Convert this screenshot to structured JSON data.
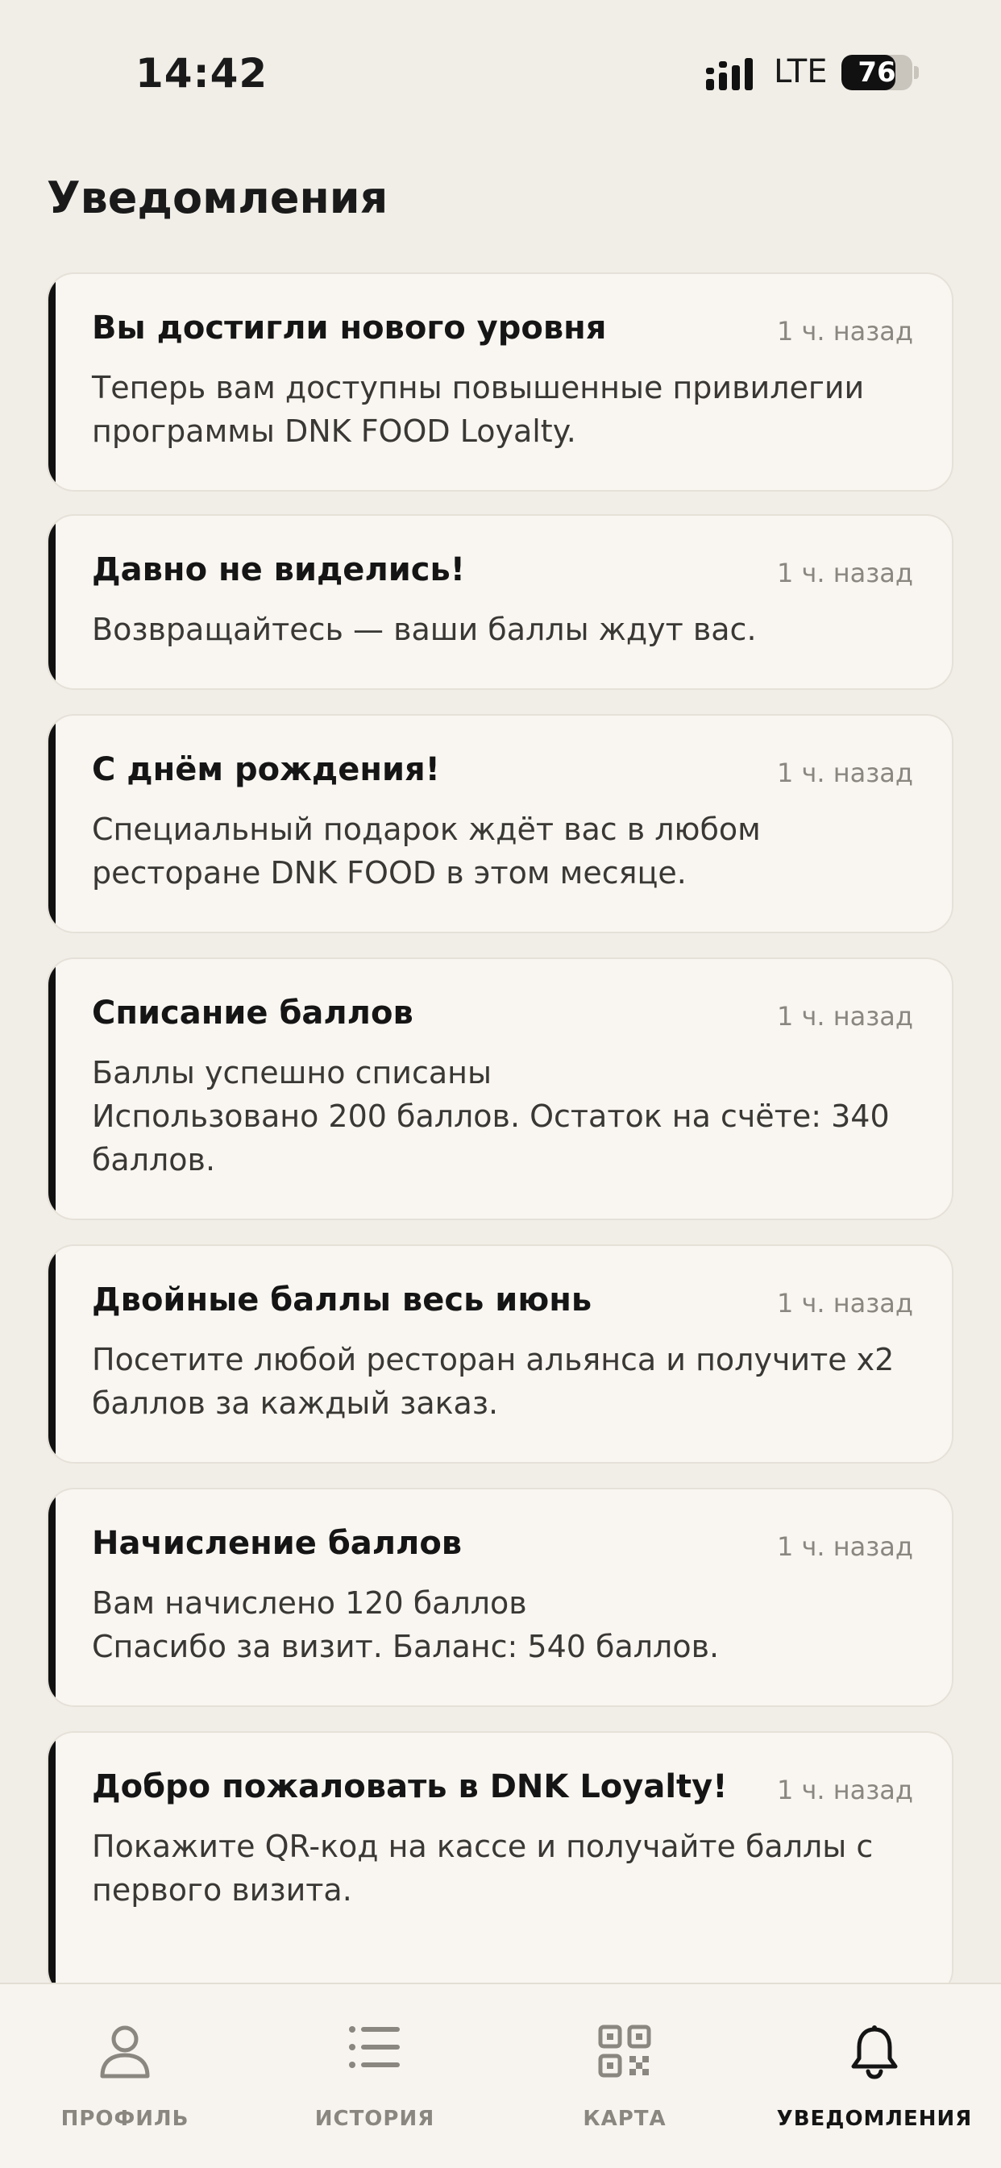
{
  "status_bar": {
    "time": "14:42",
    "network": "LTE",
    "battery_level": 76,
    "battery_text": "76"
  },
  "page_title": "Уведомления",
  "notifications": [
    {
      "title": "Вы достигли нового уровня",
      "time": "1 ч. назад",
      "lines": [
        "Теперь вам доступны повышенные привилегии",
        "программы DNK FOOD Loyalty."
      ]
    },
    {
      "title": "Давно не виделись!",
      "time": "1 ч. назад",
      "lines": [
        "Возвращайтесь — ваши баллы ждут вас."
      ]
    },
    {
      "title": "С днём рождения!",
      "time": "1 ч. назад",
      "lines": [
        "Специальный подарок ждёт вас в любом",
        "ресторане DNK FOOD в этом месяце."
      ]
    },
    {
      "title": "Списание баллов",
      "time": "1 ч. назад",
      "lines": [
        "Баллы успешно списаны",
        "Использовано 200 баллов. Остаток на счёте: 340",
        "баллов."
      ]
    },
    {
      "title": "Двойные баллы весь июнь",
      "time": "1 ч. назад",
      "lines": [
        "Посетите любой ресторан альянса и получите x2",
        "баллов за каждый заказ."
      ]
    },
    {
      "title": "Начисление баллов",
      "time": "1 ч. назад",
      "lines": [
        "Вам начислено 120 баллов",
        "Спасибо за визит. Баланс: 540 баллов."
      ]
    },
    {
      "title": "Добро пожаловать в DNK Loyalty!",
      "time": "1 ч. назад",
      "lines": [
        "Покажите QR-код на кассе и получайте баллы с",
        "первого визита."
      ]
    }
  ],
  "tabbar": {
    "tabs": [
      {
        "label": "ПРОФИЛЬ",
        "icon": "person-icon",
        "active": false
      },
      {
        "label": "ИСТОРИЯ",
        "icon": "list-icon",
        "active": false
      },
      {
        "label": "КАРТА",
        "icon": "qr-code-icon",
        "active": false
      },
      {
        "label": "УВЕДОМЛЕНИЯ",
        "icon": "bell-icon",
        "active": true
      }
    ]
  },
  "colors": {
    "background": "#f1eee8",
    "card": "#f9f6f1",
    "accent": "#111111",
    "muted": "#8a8680"
  }
}
